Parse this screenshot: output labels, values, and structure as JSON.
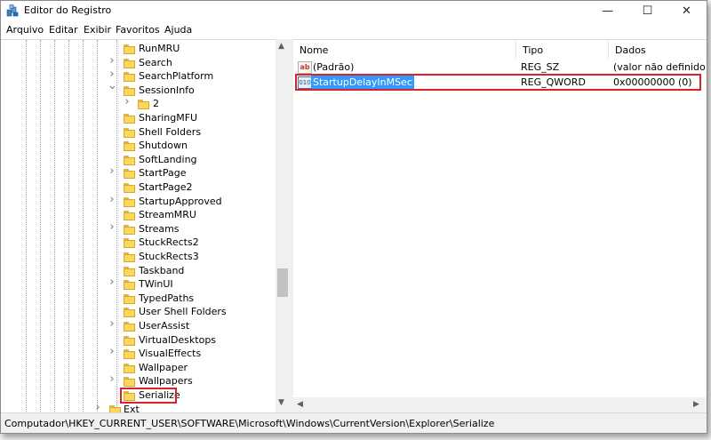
{
  "window": {
    "title": "Editor do Registro",
    "controls": {
      "minimize": "—",
      "maximize": "☐",
      "close": "✕"
    }
  },
  "menu": [
    "Arquivo",
    "Editar",
    "Exibir",
    "Favoritos",
    "Ajuda"
  ],
  "tree": {
    "items": [
      {
        "label": "RunMRU",
        "expander": "none"
      },
      {
        "label": "Search",
        "expander": "collapsed"
      },
      {
        "label": "SearchPlatform",
        "expander": "collapsed"
      },
      {
        "label": "SessionInfo",
        "expander": "expanded"
      },
      {
        "label": "2",
        "expander": "collapsed",
        "child": true
      },
      {
        "label": "SharingMFU",
        "expander": "none"
      },
      {
        "label": "Shell Folders",
        "expander": "none"
      },
      {
        "label": "Shutdown",
        "expander": "none"
      },
      {
        "label": "SoftLanding",
        "expander": "none"
      },
      {
        "label": "StartPage",
        "expander": "collapsed"
      },
      {
        "label": "StartPage2",
        "expander": "none"
      },
      {
        "label": "StartupApproved",
        "expander": "collapsed"
      },
      {
        "label": "StreamMRU",
        "expander": "none"
      },
      {
        "label": "Streams",
        "expander": "collapsed"
      },
      {
        "label": "StuckRects2",
        "expander": "none"
      },
      {
        "label": "StuckRects3",
        "expander": "none"
      },
      {
        "label": "Taskband",
        "expander": "none"
      },
      {
        "label": "TWinUI",
        "expander": "collapsed"
      },
      {
        "label": "TypedPaths",
        "expander": "none"
      },
      {
        "label": "User Shell Folders",
        "expander": "none"
      },
      {
        "label": "UserAssist",
        "expander": "collapsed"
      },
      {
        "label": "VirtualDesktops",
        "expander": "none"
      },
      {
        "label": "VisualEffects",
        "expander": "collapsed"
      },
      {
        "label": "Wallpaper",
        "expander": "none"
      },
      {
        "label": "Wallpapers",
        "expander": "collapsed"
      },
      {
        "label": "Serialize",
        "expander": "none",
        "selected": true
      },
      {
        "label": "Ext",
        "expander": "collapsed",
        "parent_level": true
      }
    ]
  },
  "list": {
    "columns": [
      "Nome",
      "Tipo",
      "Dados"
    ],
    "rows": [
      {
        "icon": "ab",
        "name": "(Padrão)",
        "type": "REG_SZ",
        "data": "(valor não definido)"
      },
      {
        "icon": "010",
        "name": "StartupDelayInMSec",
        "type": "REG_QWORD",
        "data": "0x00000000 (0)",
        "selected": true
      }
    ]
  },
  "status": {
    "path": "Computador\\HKEY_CURRENT_USER\\SOFTWARE\\Microsoft\\Windows\\CurrentVersion\\Explorer\\Serialize"
  },
  "colors": {
    "highlight_border": "#d9232a",
    "selection": "#3399ff"
  }
}
